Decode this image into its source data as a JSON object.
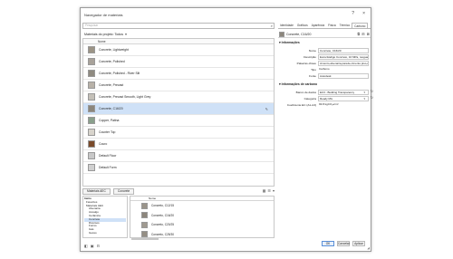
{
  "window": {
    "title": "Navegador de materiais",
    "help": "?",
    "close": "×"
  },
  "search": {
    "placeholder": "Pesquisar"
  },
  "library": {
    "label": "Materiais do projeto: Todos",
    "filter_icon": "▾"
  },
  "list": {
    "header": "Nome",
    "items": [
      {
        "label": "Concrete, Lightweight",
        "color": "#9c9486"
      },
      {
        "label": "Concrete, Polished",
        "color": "#a8a29a"
      },
      {
        "label": "Concrete, Polished - River Silt",
        "color": "#8f8a80"
      },
      {
        "label": "Concrete, Precast",
        "color": "#b8b2a8"
      },
      {
        "label": "Concrete, Precast Smooth, Light Grey",
        "color": "#c4c0b8"
      },
      {
        "label": "Concrete, C16/20",
        "color": "#8c867c"
      },
      {
        "label": "Copper, Patina",
        "color": "#8aa08c"
      },
      {
        "label": "Counter Top",
        "color": "#d8d4cc"
      },
      {
        "label": "Couro",
        "color": "#7a4a2a"
      },
      {
        "label": "Default Floor",
        "color": "#c8c8c8"
      },
      {
        "label": "Default Form",
        "color": "#d0d0d0"
      }
    ],
    "selected_index": 5
  },
  "bottom_tabs": [
    "Materiais AEC",
    "Concrete"
  ],
  "tree": {
    "title": "Início",
    "items": [
      "Favoritos",
      "Materiais AEC",
      "Alvenaria",
      "Acoalgo",
      "Cerâmica",
      "Concrete",
      "Diversos",
      "Forros",
      "Gás",
      "Gesso"
    ]
  },
  "grid": {
    "header": "Nome",
    "items": [
      {
        "label": "Concreto, C12/15",
        "color": "#9a948a"
      },
      {
        "label": "Concreto, C16/20",
        "color": "#8c867c"
      },
      {
        "label": "Concreto, C20/25",
        "color": "#a09a90"
      },
      {
        "label": "Concreto, C25/30",
        "color": "#948e84"
      }
    ]
  },
  "props": {
    "tabs": [
      "Identidade",
      "Gráficos",
      "Aparência",
      "Física",
      "Térmico",
      "Carbono"
    ],
    "active_tab": 5,
    "material_name": "Concrete, C16/20",
    "info_section": "Informações",
    "fields": [
      {
        "k": "Nome",
        "v": "Concrete, C16/20"
      },
      {
        "k": "Descrição",
        "v": "Euroc&ódigo Concreto, 16 MPa, resguarnt gendimento calçadas para PrecastPavimen..."
      },
      {
        "k": "Palavras-chave",
        "v": "cimento,alvenaria,parede,cimento,piso,calçadassa,laje,pavimento,pavimentação..."
      },
      {
        "k": "Tipo",
        "v": "Carbono"
      },
      {
        "k": "Fonte",
        "v": "Autodesk"
      }
    ],
    "carbon_section": "Informações de carbono",
    "carbon": [
      {
        "k": "Banco de dados",
        "v": "EC3 - Building Transparency"
      },
      {
        "k": "Categoria",
        "v": "Ready Mix"
      },
      {
        "k": "Coeficiente EC (A1-A3)",
        "v": "93.8 kgCO₂e/m³"
      }
    ]
  },
  "buttons": {
    "ok": "OK",
    "cancel": "Cancelar",
    "apply": "Aplicar"
  }
}
